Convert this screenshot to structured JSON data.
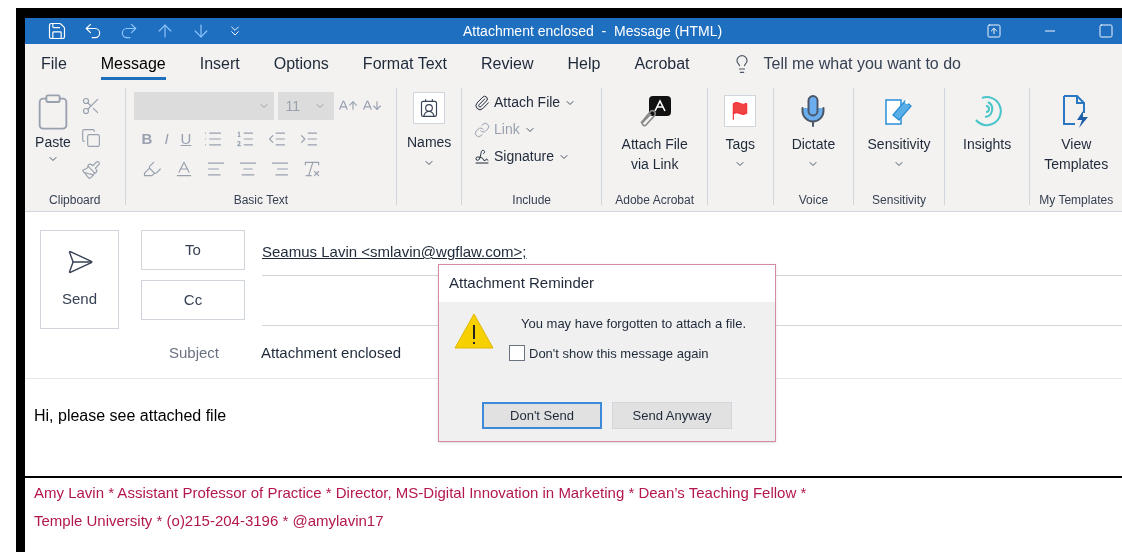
{
  "window": {
    "title": "Attachment enclosed  -  Message (HTML)"
  },
  "tabs": [
    {
      "label": "File",
      "selected": false
    },
    {
      "label": "Message",
      "selected": true
    },
    {
      "label": "Insert",
      "selected": false
    },
    {
      "label": "Options",
      "selected": false
    },
    {
      "label": "Format Text",
      "selected": false
    },
    {
      "label": "Review",
      "selected": false
    },
    {
      "label": "Help",
      "selected": false
    },
    {
      "label": "Acrobat",
      "selected": false
    }
  ],
  "tell_me": {
    "placeholder": "Tell me what you want to do"
  },
  "ribbon": {
    "clipboard": {
      "label": "Clipboard",
      "paste": {
        "label": "Paste",
        "dropdown": true
      }
    },
    "basic_text": {
      "label": "Basic Text",
      "font_size": {
        "value": "11",
        "disabled": true
      },
      "format_buttons": [
        "B",
        "I",
        "U"
      ]
    },
    "names": {
      "label": "Names",
      "dropdown": true
    },
    "include": {
      "label": "Include",
      "buttons": [
        {
          "label": "Attach File",
          "dropdown": true,
          "disabled": false
        },
        {
          "label": "Link",
          "dropdown": true,
          "disabled": true
        },
        {
          "label": "Signature",
          "dropdown": true,
          "disabled": false
        }
      ]
    },
    "groups": [
      {
        "label": "Adobe Acrobat",
        "button": {
          "label": "Attach File via Link",
          "dropdown": false
        }
      },
      {
        "button": {
          "label": "Tags",
          "dropdown": true
        }
      },
      {
        "label": "Voice",
        "button": {
          "label": "Dictate",
          "dropdown": true
        }
      },
      {
        "label": "Sensitivity",
        "button": {
          "label": "Sensitivity",
          "dropdown": true
        }
      },
      {
        "button": {
          "label": "Insights",
          "dropdown": false
        }
      },
      {
        "label": "My Templates",
        "button": {
          "label": "View Templates",
          "dropdown": false
        }
      }
    ]
  },
  "compose": {
    "send": "Send",
    "to": {
      "label": "To",
      "value": "Seamus Lavin <smlavin@wgflaw.com>;"
    },
    "cc": {
      "label": "Cc"
    },
    "subject": {
      "label": "Subject",
      "value": "Attachment enclosed"
    },
    "body": "Hi, please see attached file",
    "signature": [
      "Amy Lavin * Assistant Professor of Practice * Director, MS-Digital Innovation in Marketing * Dean’s Teaching Fellow *",
      "Temple University * (o)215-204-3196 * @amylavin17"
    ]
  },
  "dialog": {
    "title": "Attachment Reminder",
    "message": "You may have forgotten to attach a file.",
    "checkbox": {
      "label": "Don't show this message again",
      "checked": false
    },
    "buttons": [
      {
        "label": "Don't Send",
        "default": true
      },
      {
        "label": "Send Anyway",
        "default": false
      }
    ]
  }
}
